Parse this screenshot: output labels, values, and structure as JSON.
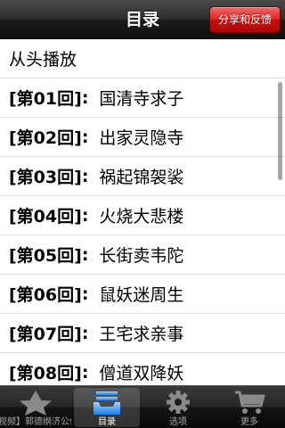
{
  "navbar": {
    "title": "目录",
    "share_button": "分享和反馈"
  },
  "list": {
    "first_item": "从头播放",
    "chapters": [
      {
        "num": "[第01回]",
        "sep": ":",
        "title": "国清寺求子"
      },
      {
        "num": "[第02回]",
        "sep": ":",
        "title": "出家灵隐寺"
      },
      {
        "num": "[第03回]",
        "sep": ":",
        "title": "祸起锦袈裟"
      },
      {
        "num": "[第04回]",
        "sep": ":",
        "title": "火烧大悲楼"
      },
      {
        "num": "[第05回]",
        "sep": ":",
        "title": "长街卖韦陀"
      },
      {
        "num": "[第06回]",
        "sep": ":",
        "title": "鼠妖迷周生"
      },
      {
        "num": "[第07回]",
        "sep": ":",
        "title": "王宅求亲事"
      },
      {
        "num": "[第08回]",
        "sep": ":",
        "title": "僧道双降妖"
      }
    ]
  },
  "tabbar": {
    "tabs": [
      {
        "label": "视频】郭德纲济公传(上)",
        "icon": "star-icon"
      },
      {
        "label": "目录",
        "icon": "inbox-tray-icon"
      },
      {
        "label": "选项",
        "icon": "gear-icon"
      },
      {
        "label": "更多",
        "icon": "cart-icon"
      }
    ],
    "active_index": 1
  }
}
